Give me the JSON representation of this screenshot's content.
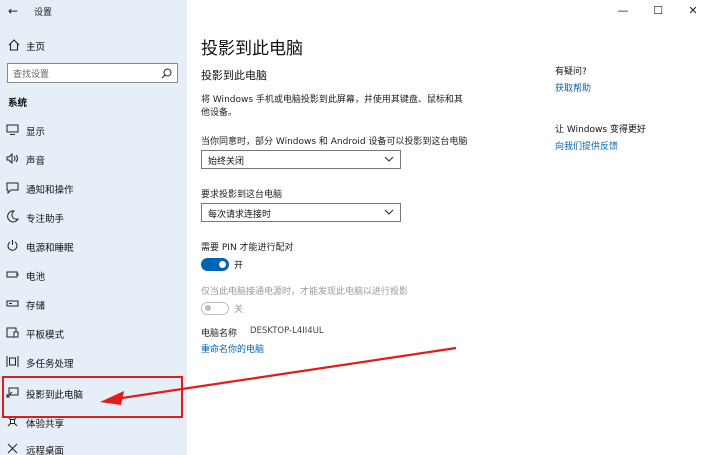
{
  "window": {
    "title": "设置",
    "minimize": "—",
    "maximize": "☐",
    "close": "✕"
  },
  "sidebar": {
    "home": "主页",
    "search_placeholder": "查找设置",
    "section": "系统",
    "items": [
      {
        "label": "显示",
        "icon": "monitor-icon"
      },
      {
        "label": "声音",
        "icon": "speaker-icon"
      },
      {
        "label": "通知和操作",
        "icon": "notification-icon"
      },
      {
        "label": "专注助手",
        "icon": "moon-icon"
      },
      {
        "label": "电源和睡眠",
        "icon": "power-icon"
      },
      {
        "label": "电池",
        "icon": "battery-icon"
      },
      {
        "label": "存储",
        "icon": "storage-icon"
      },
      {
        "label": "平板模式",
        "icon": "tablet-icon"
      },
      {
        "label": "多任务处理",
        "icon": "multitask-icon"
      },
      {
        "label": "投影到此电脑",
        "icon": "project-icon"
      },
      {
        "label": "体验共享",
        "icon": "share-icon"
      },
      {
        "label": "远程桌面",
        "icon": "remote-icon"
      }
    ]
  },
  "main": {
    "title": "投影到此电脑",
    "subtitle": "投影到此电脑",
    "description": "将 Windows 手机或电脑投影到此屏幕，并使用其键盘、鼠标和其他设备。",
    "availability_label": "当你同意时，部分 Windows 和 Android 设备可以投影到这台电脑",
    "availability_value": "始终关闭",
    "ask_label": "要求投影到这台电脑",
    "ask_value": "每次请求连接时",
    "pin_label": "需要 PIN 才能进行配对",
    "pin_state": "开",
    "power_label": "仅当此电脑接通电源时，才能发现此电脑以进行投影",
    "power_state": "关",
    "pc_name_label": "电脑名称",
    "pc_name_value": "DESKTOP-L4II4UL",
    "rename_link": "重命名你的电脑"
  },
  "right": {
    "question_head": "有疑问?",
    "help_link": "获取帮助",
    "improve_head": "让 Windows 变得更好",
    "feedback_link": "向我们提供反馈"
  },
  "colors": {
    "accent": "#0063b1",
    "annotation": "#e21b1b",
    "sidebar_bg": "#e6eef7"
  }
}
